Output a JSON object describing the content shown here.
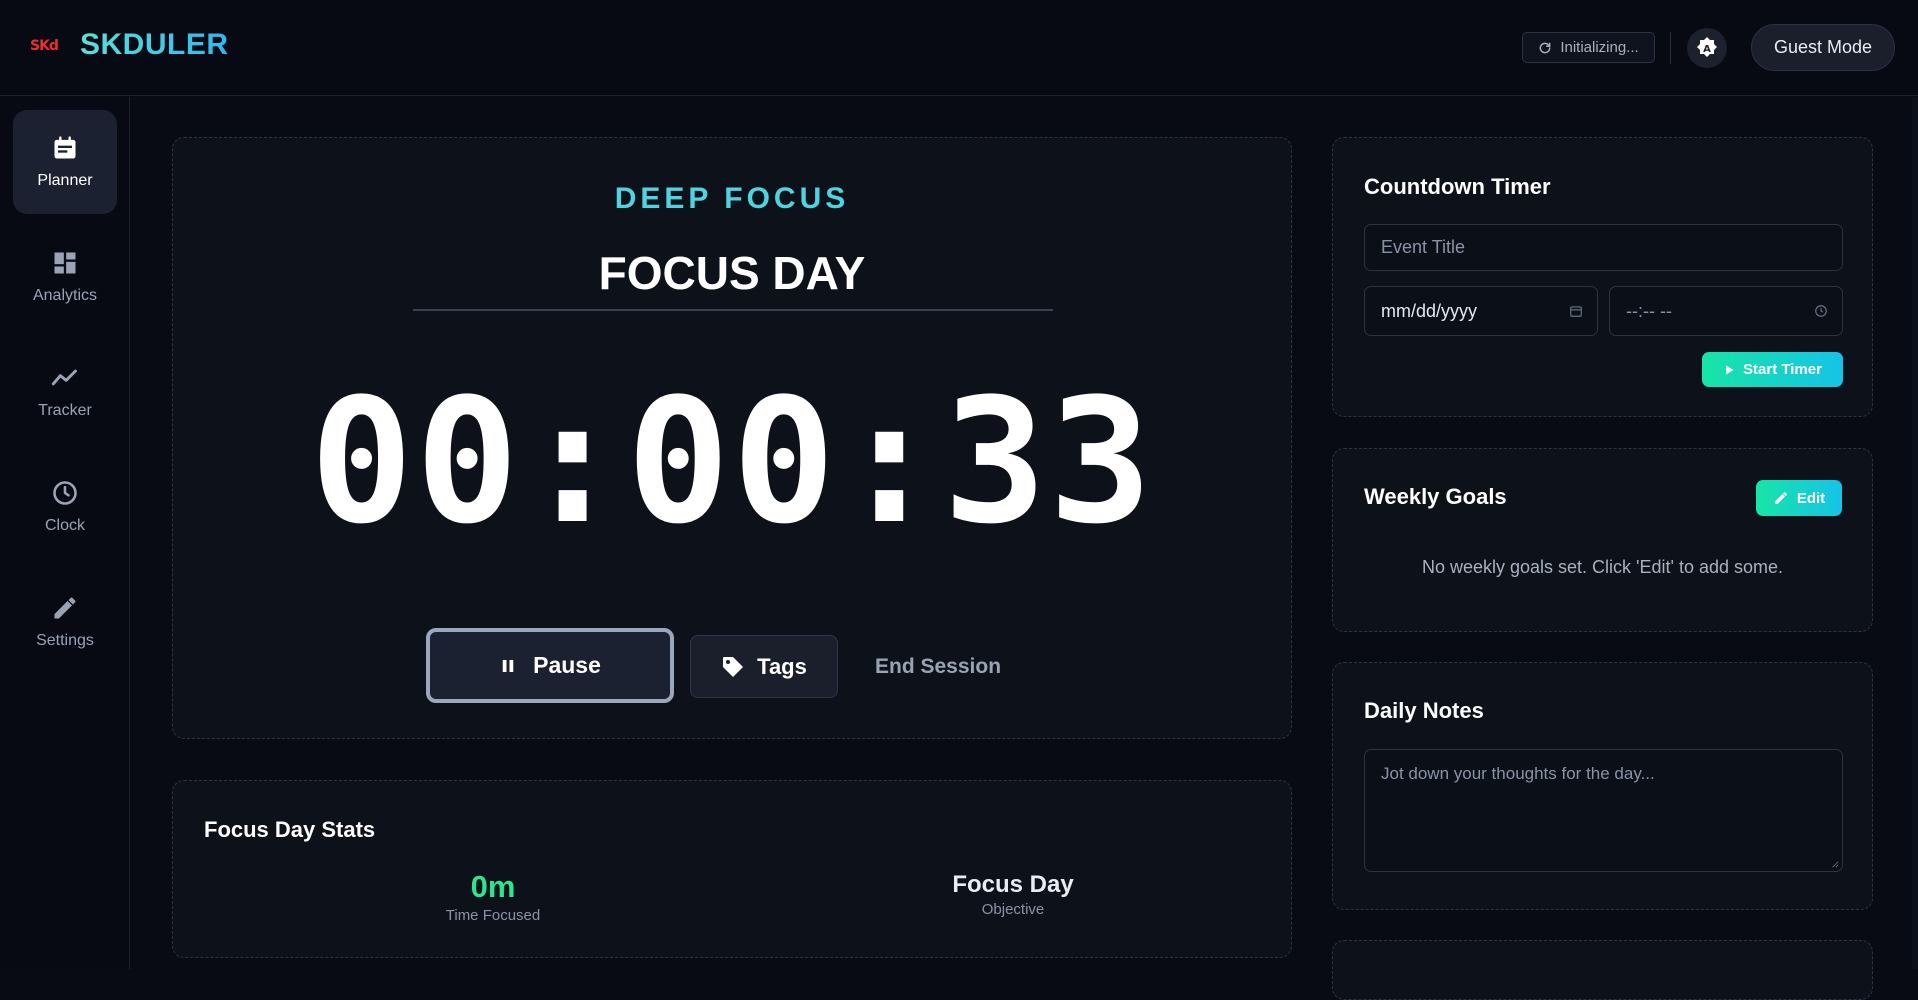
{
  "header": {
    "logo_mark": "SKd",
    "brand": "SKDULER",
    "status": "Initializing...",
    "guest_label": "Guest Mode"
  },
  "sidebar": {
    "items": [
      {
        "label": "Planner",
        "icon": "calendar-icon",
        "active": true
      },
      {
        "label": "Analytics",
        "icon": "dashboard-icon",
        "active": false
      },
      {
        "label": "Tracker",
        "icon": "trend-line-icon",
        "active": false
      },
      {
        "label": "Clock",
        "icon": "clock-icon",
        "active": false
      },
      {
        "label": "Settings",
        "icon": "pencil-icon",
        "active": false
      }
    ]
  },
  "focus": {
    "mode": "DEEP FOCUS",
    "title": "FOCUS DAY",
    "timer": "00:00:33",
    "pause_label": "Pause",
    "tags_label": "Tags",
    "end_label": "End Session"
  },
  "stats": {
    "heading": "Focus Day Stats",
    "time_value": "0m",
    "time_caption": "Time Focused",
    "objective_value": "Focus Day",
    "objective_caption": "Objective"
  },
  "countdown": {
    "heading": "Countdown Timer",
    "title_placeholder": "Event Title",
    "date_placeholder": "mm/dd/yyyy",
    "time_placeholder": "--:-- --",
    "start_label": "Start Timer"
  },
  "goals": {
    "heading": "Weekly Goals",
    "edit_label": "Edit",
    "empty_message": "No weekly goals set. Click 'Edit' to add some."
  },
  "notes": {
    "heading": "Daily Notes",
    "placeholder": "Jot down your thoughts for the day..."
  },
  "colors": {
    "accent_cyan": "#4fd3e0",
    "accent_green": "#2ee58f",
    "logo_red": "#ef2b2b",
    "gradient_start": "#17e5a6",
    "gradient_end": "#16c3e8"
  }
}
